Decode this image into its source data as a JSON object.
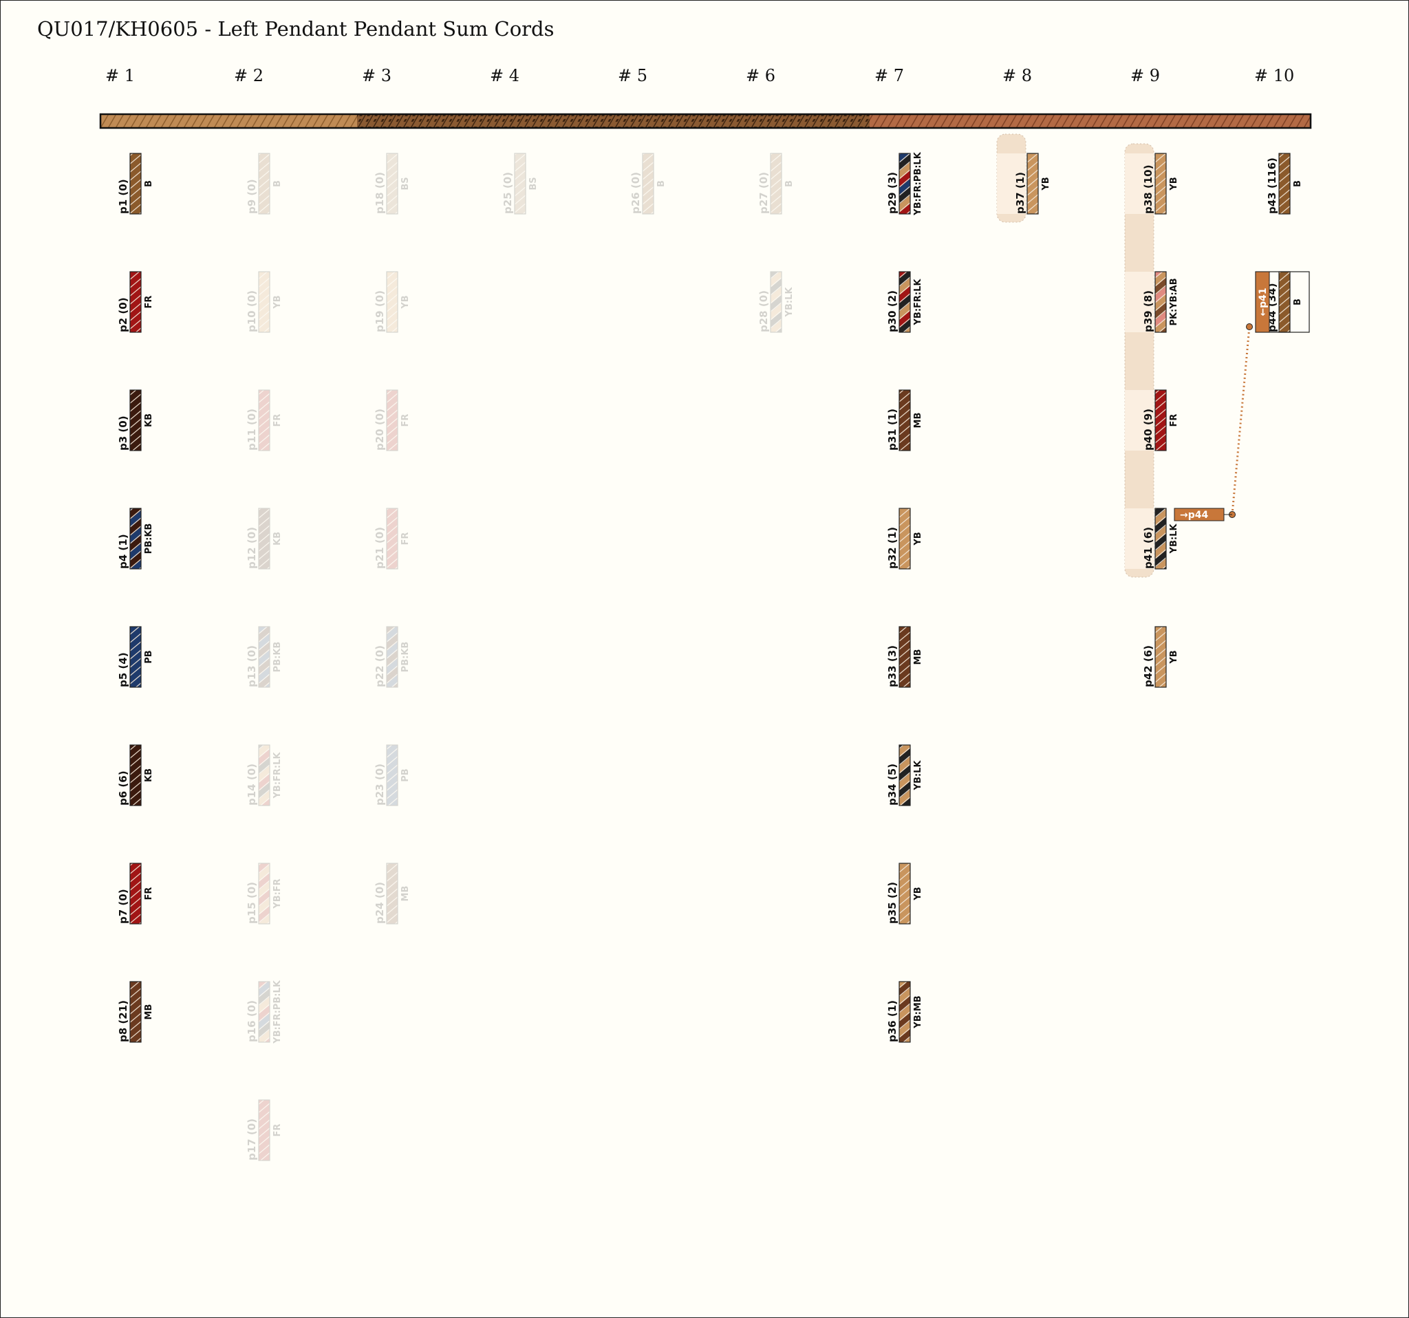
{
  "title": "QU017/KH0605 - Left Pendant Pendant Sum Cords",
  "columns": [
    "# 1",
    "# 2",
    "# 3",
    "# 4",
    "# 5",
    "# 6",
    "# 7",
    "# 8",
    "# 9",
    "# 10"
  ],
  "primary_cord_segments": [
    {
      "style": "tan",
      "colors": [
        "#c08b55",
        "#8a5a2b"
      ]
    },
    {
      "style": "mottled",
      "colors": [
        "#8a5a32",
        "#3a2210"
      ]
    },
    {
      "style": "rust",
      "colors": [
        "#b36a45",
        "#7a3d22"
      ]
    }
  ],
  "cords": [
    {
      "id": "p1 (0)",
      "colors": "B",
      "col": 0,
      "row": 0,
      "ghost": false,
      "fill": [
        "#8b5a2b"
      ]
    },
    {
      "id": "p2 (0)",
      "colors": "FR",
      "col": 0,
      "row": 1,
      "ghost": false,
      "fill": [
        "#a11515"
      ]
    },
    {
      "id": "p3 (0)",
      "colors": "KB",
      "col": 0,
      "row": 2,
      "ghost": false,
      "fill": [
        "#3b1a0e"
      ]
    },
    {
      "id": "p4 (1)",
      "colors": "PB:KB",
      "col": 0,
      "row": 3,
      "ghost": false,
      "fill": [
        "#1e3a6b",
        "#3b1a0e"
      ]
    },
    {
      "id": "p5 (4)",
      "colors": "PB",
      "col": 0,
      "row": 4,
      "ghost": false,
      "fill": [
        "#1e3a6b"
      ]
    },
    {
      "id": "p6 (6)",
      "colors": "KB",
      "col": 0,
      "row": 5,
      "ghost": false,
      "fill": [
        "#3b1a0e"
      ]
    },
    {
      "id": "p7 (0)",
      "colors": "FR",
      "col": 0,
      "row": 6,
      "ghost": false,
      "fill": [
        "#a11515"
      ]
    },
    {
      "id": "p8 (21)",
      "colors": "MB",
      "col": 0,
      "row": 7,
      "ghost": false,
      "fill": [
        "#6b3a1f"
      ]
    },
    {
      "id": "p9 (0)",
      "colors": "B",
      "col": 1,
      "row": 0,
      "ghost": true,
      "fill": [
        "#8b5a2b"
      ]
    },
    {
      "id": "p10 (0)",
      "colors": "YB",
      "col": 1,
      "row": 1,
      "ghost": true,
      "fill": [
        "#c9955e"
      ]
    },
    {
      "id": "p11 (0)",
      "colors": "FR",
      "col": 1,
      "row": 2,
      "ghost": true,
      "fill": [
        "#a11515"
      ]
    },
    {
      "id": "p12 (0)",
      "colors": "KB",
      "col": 1,
      "row": 3,
      "ghost": true,
      "fill": [
        "#3b1a0e"
      ]
    },
    {
      "id": "p13 (0)",
      "colors": "PB:KB",
      "col": 1,
      "row": 4,
      "ghost": true,
      "fill": [
        "#1e3a6b",
        "#3b1a0e"
      ]
    },
    {
      "id": "p14 (0)",
      "colors": "YB:FR:LK",
      "col": 1,
      "row": 5,
      "ghost": true,
      "fill": [
        "#c9955e",
        "#a11515",
        "#222"
      ]
    },
    {
      "id": "p15 (0)",
      "colors": "YB:FR",
      "col": 1,
      "row": 6,
      "ghost": true,
      "fill": [
        "#c9955e",
        "#a11515"
      ]
    },
    {
      "id": "p16 (0)",
      "colors": "YB:FR:PB:LK",
      "col": 1,
      "row": 7,
      "ghost": true,
      "fill": [
        "#c9955e",
        "#a11515",
        "#1e3a6b",
        "#222"
      ]
    },
    {
      "id": "p17 (0)",
      "colors": "FR",
      "col": 1,
      "row": 8,
      "ghost": true,
      "fill": [
        "#a11515"
      ]
    },
    {
      "id": "p18 (0)",
      "colors": "BS",
      "col": 2,
      "row": 0,
      "ghost": true,
      "fill": [
        "#9b7a55"
      ]
    },
    {
      "id": "p19 (0)",
      "colors": "YB",
      "col": 2,
      "row": 1,
      "ghost": true,
      "fill": [
        "#c9955e"
      ]
    },
    {
      "id": "p20 (0)",
      "colors": "FR",
      "col": 2,
      "row": 2,
      "ghost": true,
      "fill": [
        "#a11515"
      ]
    },
    {
      "id": "p21 (0)",
      "colors": "FR",
      "col": 2,
      "row": 3,
      "ghost": true,
      "fill": [
        "#a11515"
      ]
    },
    {
      "id": "p22 (0)",
      "colors": "PB:KB",
      "col": 2,
      "row": 4,
      "ghost": true,
      "fill": [
        "#1e3a6b",
        "#3b1a0e"
      ]
    },
    {
      "id": "p23 (0)",
      "colors": "PB",
      "col": 2,
      "row": 5,
      "ghost": true,
      "fill": [
        "#1e3a6b"
      ]
    },
    {
      "id": "p24 (0)",
      "colors": "MB",
      "col": 2,
      "row": 6,
      "ghost": true,
      "fill": [
        "#6b3a1f"
      ]
    },
    {
      "id": "p25 (0)",
      "colors": "BS",
      "col": 3,
      "row": 0,
      "ghost": true,
      "fill": [
        "#9b7a55"
      ]
    },
    {
      "id": "p26 (0)",
      "colors": "B",
      "col": 4,
      "row": 0,
      "ghost": true,
      "fill": [
        "#8b5a2b"
      ]
    },
    {
      "id": "p27 (0)",
      "colors": "B",
      "col": 5,
      "row": 0,
      "ghost": true,
      "fill": [
        "#8b5a2b"
      ]
    },
    {
      "id": "p28 (0)",
      "colors": "YB:LK",
      "col": 5,
      "row": 1,
      "ghost": true,
      "fill": [
        "#c9955e",
        "#222"
      ]
    },
    {
      "id": "p29 (3)",
      "colors": "YB:FR:PB:LK",
      "col": 6,
      "row": 0,
      "ghost": false,
      "fill": [
        "#c9955e",
        "#a11515",
        "#1e3a6b",
        "#222"
      ]
    },
    {
      "id": "p30 (2)",
      "colors": "YB:FR:LK",
      "col": 6,
      "row": 1,
      "ghost": false,
      "fill": [
        "#c9955e",
        "#a11515",
        "#222"
      ]
    },
    {
      "id": "p31 (1)",
      "colors": "MB",
      "col": 6,
      "row": 2,
      "ghost": false,
      "fill": [
        "#6b3a1f"
      ]
    },
    {
      "id": "p32 (1)",
      "colors": "YB",
      "col": 6,
      "row": 3,
      "ghost": false,
      "fill": [
        "#c9955e"
      ]
    },
    {
      "id": "p33 (3)",
      "colors": "MB",
      "col": 6,
      "row": 4,
      "ghost": false,
      "fill": [
        "#6b3a1f"
      ]
    },
    {
      "id": "p34 (5)",
      "colors": "YB:LK",
      "col": 6,
      "row": 5,
      "ghost": false,
      "fill": [
        "#c9955e",
        "#222"
      ]
    },
    {
      "id": "p35 (2)",
      "colors": "YB",
      "col": 6,
      "row": 6,
      "ghost": false,
      "fill": [
        "#c9955e"
      ]
    },
    {
      "id": "p36 (1)",
      "colors": "YB:MB",
      "col": 6,
      "row": 7,
      "ghost": false,
      "fill": [
        "#c9955e",
        "#6b3a1f"
      ]
    },
    {
      "id": "p37 (1)",
      "colors": "YB",
      "col": 7,
      "row": 0,
      "ghost": false,
      "fill": [
        "#c9955e"
      ]
    },
    {
      "id": "p38 (10)",
      "colors": "YB",
      "col": 8,
      "row": 0,
      "ghost": false,
      "fill": [
        "#c9955e"
      ]
    },
    {
      "id": "p39 (8)",
      "colors": "PK:YB:AB",
      "col": 8,
      "row": 1,
      "ghost": false,
      "fill": [
        "#e08a80",
        "#c9955e",
        "#7a4a2a"
      ]
    },
    {
      "id": "p40 (9)",
      "colors": "FR",
      "col": 8,
      "row": 2,
      "ghost": false,
      "fill": [
        "#a11515"
      ]
    },
    {
      "id": "p41 (6)",
      "colors": "YB:LK",
      "col": 8,
      "row": 3,
      "ghost": false,
      "fill": [
        "#c9955e",
        "#222"
      ]
    },
    {
      "id": "p42 (6)",
      "colors": "YB",
      "col": 8,
      "row": 4,
      "ghost": false,
      "fill": [
        "#c9955e"
      ]
    },
    {
      "id": "p43 (116)",
      "colors": "B",
      "col": 9,
      "row": 0,
      "ghost": false,
      "fill": [
        "#8b5a2b"
      ]
    },
    {
      "id": "p44 (34)",
      "colors": "B",
      "col": 9,
      "row": 1,
      "ghost": false,
      "fill": [
        "#8b5a2b"
      ]
    }
  ],
  "links": {
    "to_label": "→p44",
    "from_label": "←p41",
    "color": "#c8773a"
  },
  "highlight_color": "#e8c9a8"
}
